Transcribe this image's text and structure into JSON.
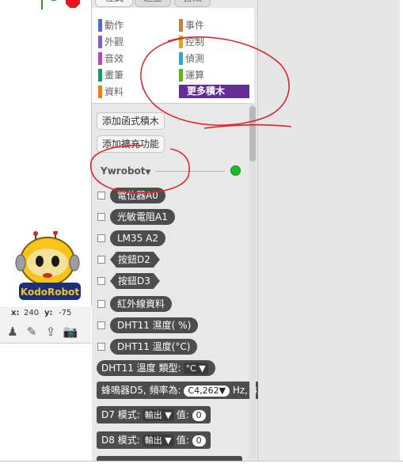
{
  "tabs": [
    "程式",
    "造型",
    "音效"
  ],
  "categories": {
    "left": [
      {
        "label": "動作",
        "color": "#4a6cd4"
      },
      {
        "label": "外觀",
        "color": "#8a55d7"
      },
      {
        "label": "音效",
        "color": "#bb42c3"
      },
      {
        "label": "畫筆",
        "color": "#0e9a6c"
      },
      {
        "label": "資料",
        "color": "#ee7d16"
      }
    ],
    "right": [
      {
        "label": "事件",
        "color": "#c88330"
      },
      {
        "label": "控制",
        "color": "#e1a91a"
      },
      {
        "label": "偵測",
        "color": "#2ca5e2"
      },
      {
        "label": "運算",
        "color": "#5cb712"
      }
    ],
    "more": "更多積木",
    "more_color": "#632d99"
  },
  "buttons": {
    "add_function": "添加函式積木",
    "add_extension": "添加擴充功能"
  },
  "extension": {
    "name": "Ywrobot",
    "status_color": "#1fb82b"
  },
  "reporters": [
    "電位器A0",
    "光敏電阻A1",
    "LM35 A2",
    "按鈕D2",
    "按鈕D3",
    "紅外線資料",
    "DHT11 濕度( %)",
    "DHT11 溫度(°C)"
  ],
  "blocks": {
    "dht_type": {
      "text": "DHT11 溫度 類型:",
      "value": "°C"
    },
    "buzzer": {
      "text": "蜂鳴器D5, 頻率為:",
      "value": "C4,262",
      "suffix": "Hz, B"
    },
    "d7": {
      "text": "D7 模式:",
      "mode": "輸出",
      "value_label": "值:",
      "value": "0"
    },
    "d8": {
      "text": "D8 模式:",
      "mode": "輸出",
      "value_label": "值:",
      "value": "0"
    }
  },
  "stage": {
    "x_label": "x:",
    "x_value": "240",
    "y_label": "y:",
    "y_value": "-75",
    "sprite_label": "KodoRobot"
  },
  "annotation_color": "#e0242a"
}
